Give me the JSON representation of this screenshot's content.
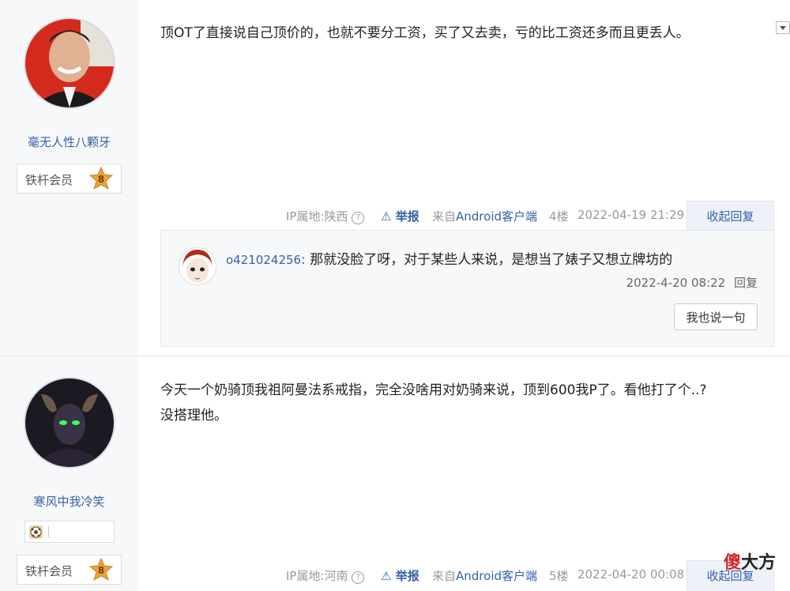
{
  "posts": [
    {
      "username": "毫无人性八颗牙",
      "member_label": "铁杆会员",
      "level": "8",
      "content": "顶OT了直接说自己顶价的，也就不要分工资，买了又去卖，亏的比工资还多而且更丢人。",
      "ip_label": "IP属地:陕西",
      "report": "举报",
      "from_prefix": "来自",
      "client": "Android客户端",
      "floor": "4楼",
      "time": "2022-04-19 21:29",
      "toggle": "收起回复",
      "reply": {
        "author": "o421024256",
        "text": "那就没脸了呀，对于某些人来说，是想当了婊子又想立牌坊的",
        "time": "2022-4-20 08:22",
        "reply_label": "回复",
        "say_button": "我也说一句"
      }
    },
    {
      "username": "寒风中我冷笑",
      "member_label": "铁杆会员",
      "level": "8",
      "content_lines": [
        "今天一个奶骑顶我祖阿曼法系戒指，完全没啥用对奶骑来说，顶到600我P了。看他打了个..?",
        "没搭理他。"
      ],
      "ip_label": "IP属地:河南",
      "report": "举报",
      "from_prefix": "来自",
      "client": "Android客户端",
      "floor": "5楼",
      "time": "2022-04-20 00:08",
      "toggle": "收起回复"
    }
  ],
  "watermark": {
    "part1": "傻",
    "part2": "大方"
  },
  "colors": {
    "link": "#3561a8",
    "sidebar": "#f7f8fa",
    "level_gold": "#e8a33a"
  }
}
